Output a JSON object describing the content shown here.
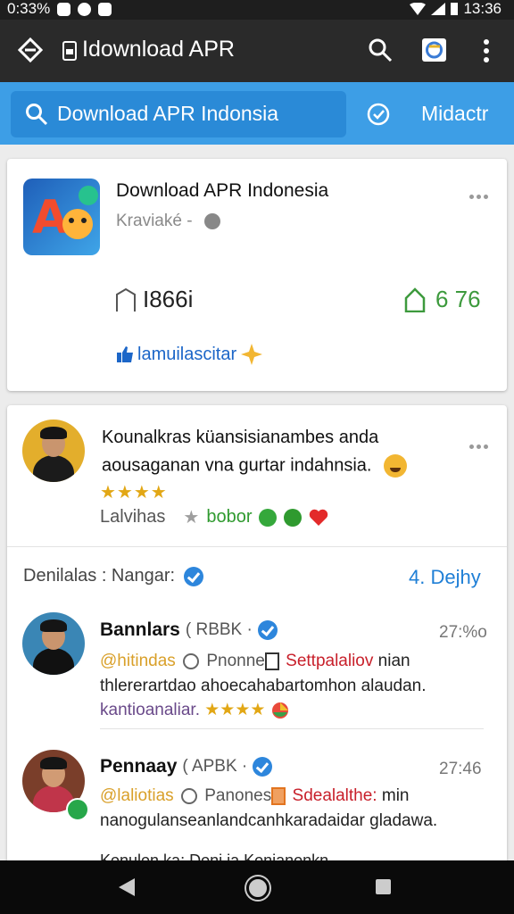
{
  "status_bar": {
    "left_text": "0:33%",
    "time": "13:36"
  },
  "app_bar": {
    "title": "Idownload APR"
  },
  "search": {
    "query": "Download APR Indonsia",
    "right_label": "Midactr"
  },
  "app_card": {
    "title": "Download APR Indonesia",
    "subtitle": "Kraviaké -",
    "stat_left": "I866i",
    "stat_right": "6 76",
    "link_label": "lamuilascitar"
  },
  "review_card": {
    "top_review": {
      "line1": "Kounalkras küansisianambes anda",
      "line2": "aousaganan vna gurtar indahnsia.",
      "stars": "★★★★",
      "meta_left": "Lalvihas",
      "meta_green": "bobor"
    },
    "section": {
      "label": "Denilalas : Nangar:",
      "right": "4. Dejhy"
    },
    "reviews": [
      {
        "name": "Bannlars",
        "handle": "( RBBK ·",
        "time": "27:%o",
        "line1_a": "@hitindas",
        "line1_b": "Pnonne",
        "line1_c": "Settpalaliov",
        "line1_d": "nian",
        "line2": "thlererartdao ahoecahabartomhon alaudan.",
        "line3": "kantioanaliar.",
        "stars": "★★★★"
      },
      {
        "name": "Pennaay",
        "handle": "( APBK ·",
        "time": "27:46",
        "line1_a": "@laliotias",
        "line1_b": "Panones",
        "line1_c": "Sdealalthe:",
        "line1_d": "min",
        "line2": "nanogulanseanlandcanhkaradaidar gladawa.",
        "line3": "Konulon ka: Doni ja Konjanonkn"
      }
    ]
  },
  "colors": {
    "app_bar": "#2a2a2a",
    "search_band": "#3d9ee6",
    "accent_blue": "#1f7fd6",
    "green": "#3d9a3d"
  }
}
